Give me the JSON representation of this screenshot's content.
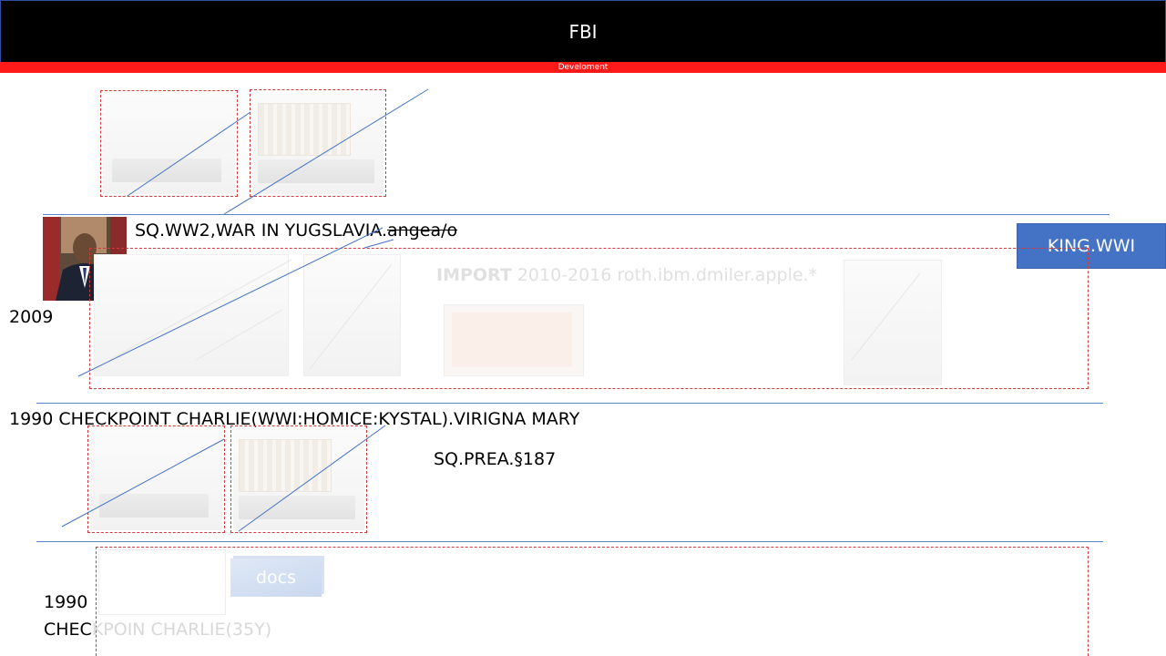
{
  "header": {
    "title": "FBI",
    "subtitle": "Develoment"
  },
  "section1": {
    "title_main": "SQ.WW2,WAR IN YUGSLAVIA.",
    "title_struck": "angea/o",
    "year_label": "2009",
    "button_label": "KING.WWI",
    "faint_heading_bold": "IMPORT",
    "faint_heading_rest": " 2010-2016 roth.ibm.dmiler.apple.*"
  },
  "section2": {
    "title": "1990 CHECKPOINT CHARLIE(WWI:HOMICE:KYSTAL).VIRIGNA MARY",
    "subtitle": "SQ.PREA.§187"
  },
  "section3": {
    "year_label": "1990",
    "caption_dark": "CHEC",
    "caption_faint": "KPOIN CHARLIE(35Y)",
    "docs_label": "docs"
  },
  "colors": {
    "header_bg": "#000000",
    "strip": "#ff1a1a",
    "button": "#4472c4",
    "divider": "#5b86c8",
    "frame": "#d23b3b"
  },
  "icons": [
    "bed-image",
    "portrait-photo",
    "connector-line"
  ]
}
